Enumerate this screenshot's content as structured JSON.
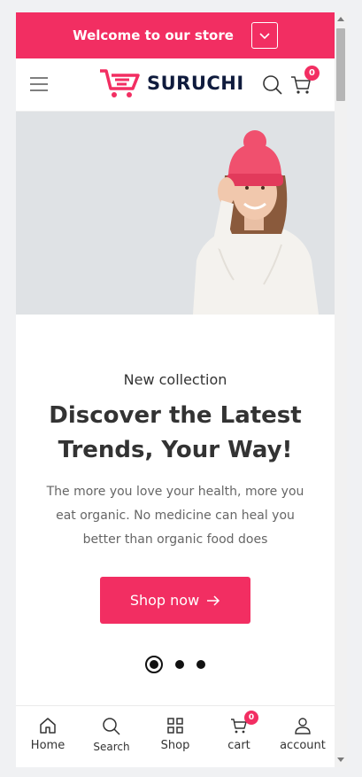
{
  "announcement": {
    "text": "Welcome to our store"
  },
  "header": {
    "brand": "SURUCHI",
    "cart_count": "0"
  },
  "hero": {
    "eyebrow": "New collection",
    "headline": "Discover the Latest Trends, Your Way!",
    "description": "The more you love your health, more you eat organic. No medicine can heal you better than organic food does",
    "cta_label": "Shop now",
    "slide_count": 3,
    "active_slide": 1
  },
  "bottom_nav": {
    "items": [
      {
        "label": "Home",
        "icon": "home-icon"
      },
      {
        "label": "Search",
        "icon": "search-icon"
      },
      {
        "label": "Shop",
        "icon": "grid-icon"
      },
      {
        "label": "cart",
        "icon": "cart-icon",
        "badge": "0"
      },
      {
        "label": "account",
        "icon": "user-icon"
      }
    ]
  },
  "colors": {
    "accent": "#f22e62",
    "brand_text": "#0f1b3d",
    "hero_bg": "#dfe2e5"
  }
}
